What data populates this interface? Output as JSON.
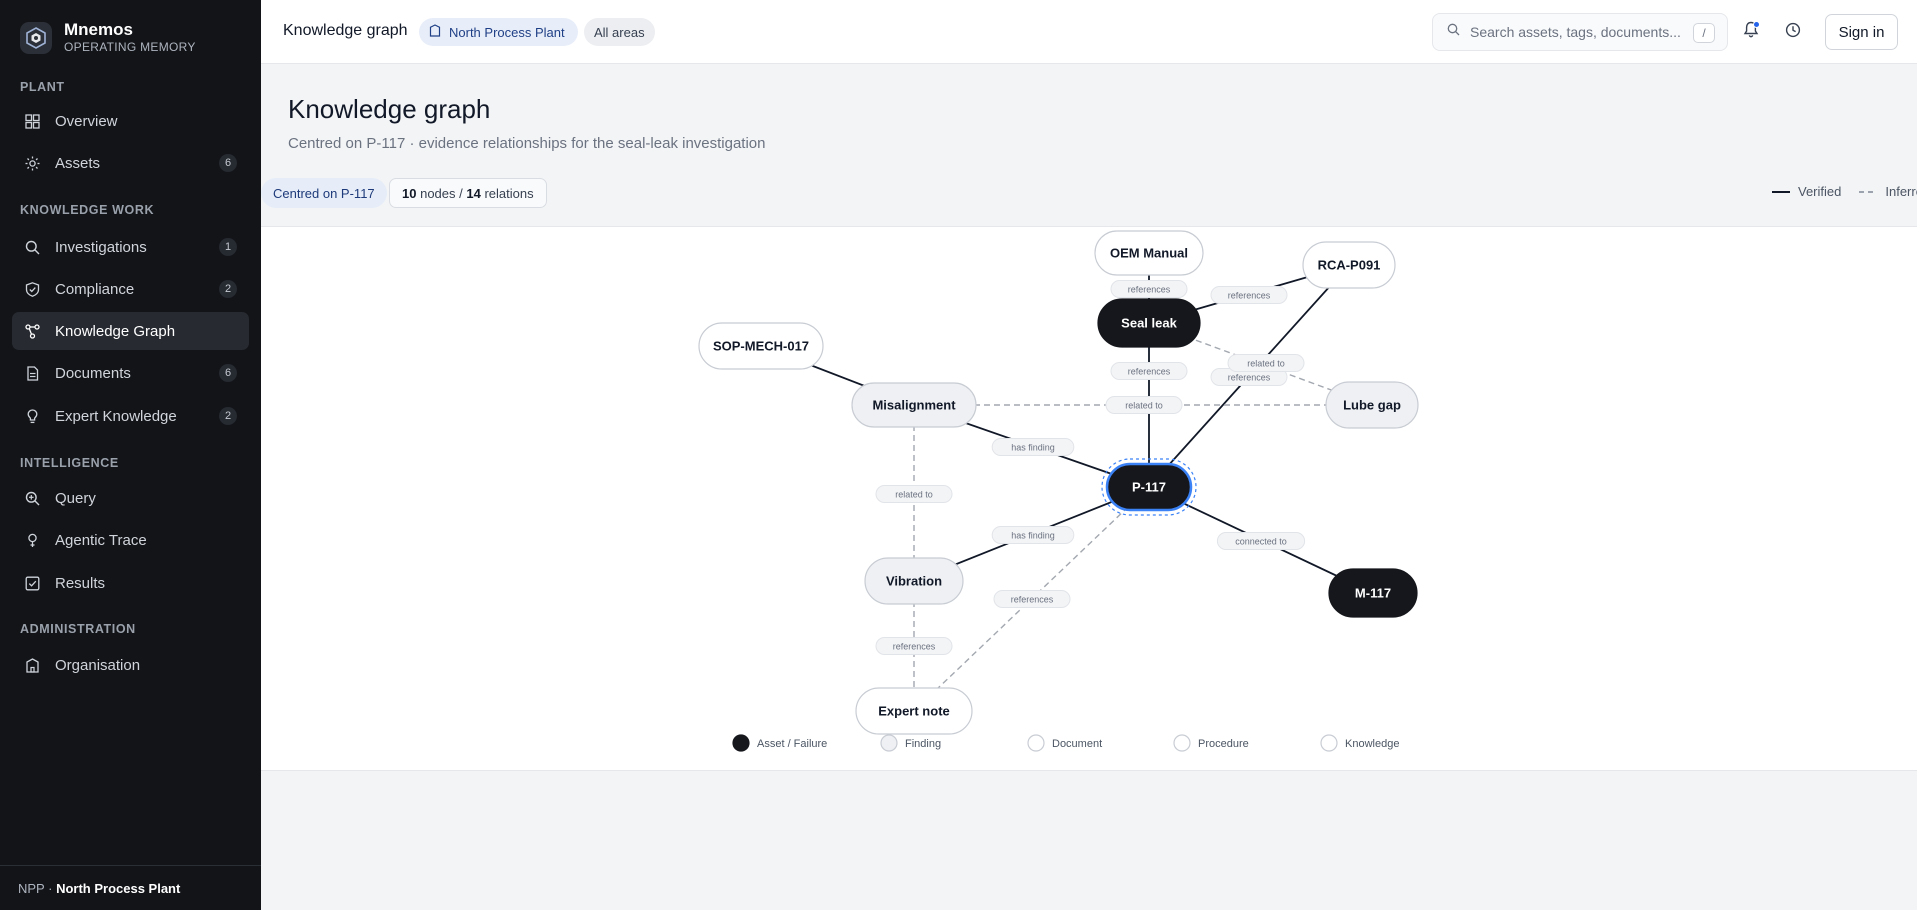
{
  "brand": {
    "name": "Mnemos",
    "subtitle": "OPERATING MEMORY"
  },
  "sidebar": {
    "sections": [
      {
        "label": "PLANT",
        "items": [
          {
            "label": "Overview",
            "icon": "grid-icon"
          },
          {
            "label": "Assets",
            "icon": "sun-icon",
            "badge": "6"
          }
        ]
      },
      {
        "label": "KNOWLEDGE WORK",
        "items": [
          {
            "label": "Investigations",
            "icon": "search-icon",
            "badge": "1"
          },
          {
            "label": "Compliance",
            "icon": "shield-icon",
            "badge": "2"
          },
          {
            "label": "Knowledge Graph",
            "icon": "graph-icon",
            "active": true
          },
          {
            "label": "Documents",
            "icon": "document-icon",
            "badge": "6"
          },
          {
            "label": "Expert Knowledge",
            "icon": "lightbulb-icon",
            "badge": "2"
          }
        ]
      },
      {
        "label": "INTELLIGENCE",
        "items": [
          {
            "label": "Query",
            "icon": "zoom-icon"
          },
          {
            "label": "Agentic Trace",
            "icon": "trace-icon"
          },
          {
            "label": "Results",
            "icon": "check-square-icon"
          }
        ]
      },
      {
        "label": "ADMINISTRATION",
        "items": [
          {
            "label": "Organisation",
            "icon": "building-icon"
          }
        ]
      }
    ],
    "footer": {
      "code": "NPP ·",
      "plant": "North Process Plant"
    }
  },
  "topbar": {
    "title": "Knowledge graph",
    "plant_chip": "North Process Plant",
    "areas_chip": "All areas",
    "search_placeholder": "Search assets, tags, documents...",
    "search_shortcut": "/",
    "signin_label": "Sign in"
  },
  "page": {
    "title": "Knowledge graph",
    "subtitle": "Centred on P-117 · evidence relationships for the seal-leak investigation",
    "centred_chip": "Centred on P-117",
    "nodes_count": "10",
    "nodes_label": "nodes /",
    "relations_count": "14",
    "relations_label": "relations",
    "legend_verified": "Verified",
    "legend_inferred": "Inferred"
  },
  "graph": {
    "nodes": [
      {
        "id": "oem",
        "label": "OEM Manual",
        "type": "Document"
      },
      {
        "id": "rca",
        "label": "RCA-P091",
        "type": "Document"
      },
      {
        "id": "seal",
        "label": "Seal leak",
        "type": "Asset / Failure"
      },
      {
        "id": "sop",
        "label": "SOP-MECH-017",
        "type": "Procedure"
      },
      {
        "id": "mis",
        "label": "Misalignment",
        "type": "Finding"
      },
      {
        "id": "lube",
        "label": "Lube gap",
        "type": "Finding"
      },
      {
        "id": "p117",
        "label": "P-117",
        "type": "Asset / Failure",
        "focus": true
      },
      {
        "id": "vib",
        "label": "Vibration",
        "type": "Finding"
      },
      {
        "id": "m117",
        "label": "M-117",
        "type": "Asset / Failure"
      },
      {
        "id": "exp",
        "label": "Expert note",
        "type": "Knowledge"
      }
    ],
    "edges": [
      {
        "from": "oem",
        "to": "seal",
        "label": "references",
        "kind": "verified"
      },
      {
        "from": "rca",
        "to": "seal",
        "label": "references",
        "kind": "verified"
      },
      {
        "from": "rca",
        "to": "p117",
        "label": "references",
        "kind": "verified"
      },
      {
        "from": "seal",
        "to": "p117",
        "label": "references",
        "kind": "verified"
      },
      {
        "from": "seal",
        "to": "lube",
        "label": "related to",
        "kind": "inferred"
      },
      {
        "from": "sop",
        "to": "mis",
        "label": "",
        "kind": "verified"
      },
      {
        "from": "mis",
        "to": "lube",
        "label": "related to",
        "kind": "inferred"
      },
      {
        "from": "mis",
        "to": "p117",
        "label": "has finding",
        "kind": "verified"
      },
      {
        "from": "mis",
        "to": "vib",
        "label": "related to",
        "kind": "inferred"
      },
      {
        "from": "vib",
        "to": "p117",
        "label": "has finding",
        "kind": "verified"
      },
      {
        "from": "p117",
        "to": "m117",
        "label": "connected to",
        "kind": "verified"
      },
      {
        "from": "vib",
        "to": "exp",
        "label": "references",
        "kind": "inferred"
      },
      {
        "from": "exp",
        "to": "p117",
        "label": "references",
        "kind": "inferred"
      }
    ],
    "legend": [
      "Asset / Failure",
      "Finding",
      "Document",
      "Procedure",
      "Knowledge"
    ]
  },
  "colors": {
    "sidebar_bg": "#121418",
    "asset_fill": "#15171c",
    "finding_fill": "#eef0f3",
    "focus_ring": "#3b82f6",
    "accent": "#2563eb"
  }
}
